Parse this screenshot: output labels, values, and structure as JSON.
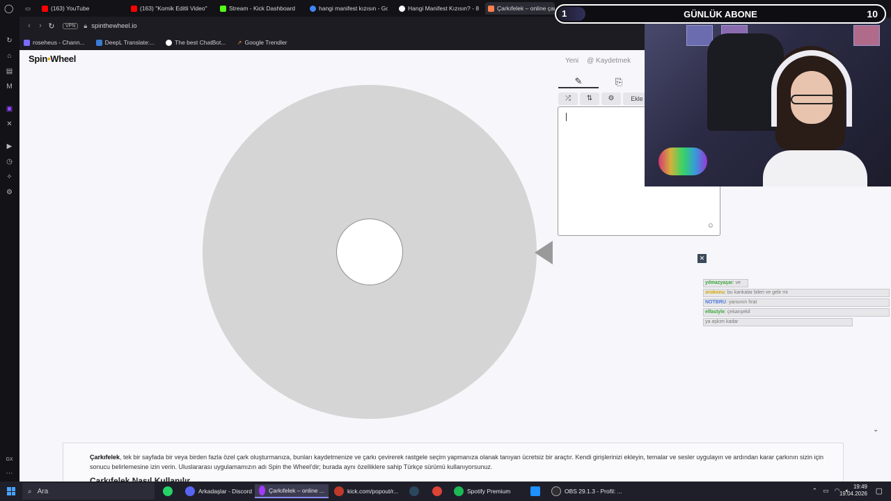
{
  "tabs": [
    {
      "label": "(163) YouTube",
      "color": "#ff0000"
    },
    {
      "label": "(163) \"Komik Editli Video\"",
      "color": "#ff0000"
    },
    {
      "label": "Stream - Kick Dashboard",
      "color": "#53fc18"
    },
    {
      "label": "hangi manifest kızısın - Go",
      "color": "#4285f4"
    },
    {
      "label": "Hangi Manifest Kızısın? - 8",
      "color": "#ffffff"
    },
    {
      "label": "Çarkıfelek – online çark",
      "color": "#ff7f50"
    }
  ],
  "address": {
    "vpn": "VPN",
    "url": "spinthewheel.io"
  },
  "bookmarks": [
    {
      "label": "roseheus - Chann...",
      "color": "#7b6cff"
    },
    {
      "label": "DeepL Translate:...",
      "color": "#0f2b46"
    },
    {
      "label": "The best ChatBot...",
      "color": "#ffffff"
    },
    {
      "label": "Google Trendler",
      "color": "#4285f4"
    }
  ],
  "page": {
    "logo_a": "Spin",
    "logo_dot": "•",
    "logo_b": "Wheel",
    "nav": {
      "new": "Yeni",
      "save": "Kaydetmek"
    },
    "toolbar": {
      "edit_icon": "✎",
      "paste_icon": "⎘",
      "shuffle_icon": "⤮",
      "sort_icon": "⇅",
      "settings_icon": "⚙",
      "add_label": "Ekle"
    },
    "entries_emoji": "☺",
    "close_icon": "✕",
    "scroll_icon": "⌄"
  },
  "chat": {
    "messages": [
      {
        "name": "yılmazyaşar",
        "text": ": ve"
      },
      {
        "name": "orokonu",
        "text": ": bu kankalar bileri ve gelir mi"
      },
      {
        "name": "NOTBRU",
        "text": ": yansının fırat"
      },
      {
        "name": "elfastyle",
        "text": ": çekanşekil"
      },
      {
        "name": "",
        "text": "ya aşkım kadar"
      }
    ],
    "colors": [
      "#3aa63a",
      "#d2a400",
      "#4a78d8",
      "#3aa63a",
      "#888888"
    ]
  },
  "article": {
    "lead": "Çarkıfelek",
    "body": ", tek bir sayfada bir veya birden fazla özel çark oluşturmanıza, bunları kaydetmenize ve çarkı çevirerek rastgele seçim yapmanıza olanak tanıyan ücretsiz bir araçtır. Kendi girişlerinizi ekleyin, temalar ve sesler uygulayın ve ardından karar çarkının sizin için sonucu belirlemesine izin verin. Uluslararası uygulamamızın adı Spin the Wheel'dir; burada aynı özelliklere sahip Türkçe sürümü kullanıyorsunuz.",
    "heading": "Çarkıfelek Nasıl Kullanılır"
  },
  "overlay": {
    "left_count": "1",
    "title": "GÜNLÜK ABONE",
    "right_count": "10"
  },
  "taskbar": {
    "search": "Ara",
    "items": [
      {
        "label": "",
        "color": "#25d366"
      },
      {
        "label": "Arkadaşlar - Discord",
        "color": "#5865f2"
      },
      {
        "label": "Çarkıfelek – online ...",
        "color": "#a23aff"
      },
      {
        "label": "kick.com/popout/r...",
        "color": "#c0392b"
      },
      {
        "label": "",
        "color": "#1b2838"
      },
      {
        "label": "",
        "color": "#db4437"
      },
      {
        "label": "Spotify Premium",
        "color": "#1db954"
      },
      {
        "label": "",
        "color": "#1e90ff"
      },
      {
        "label": "OBS 29.1.3 - Profil: ...",
        "color": "#302e31"
      }
    ],
    "time": "19:49",
    "date": "19.04.2026"
  }
}
